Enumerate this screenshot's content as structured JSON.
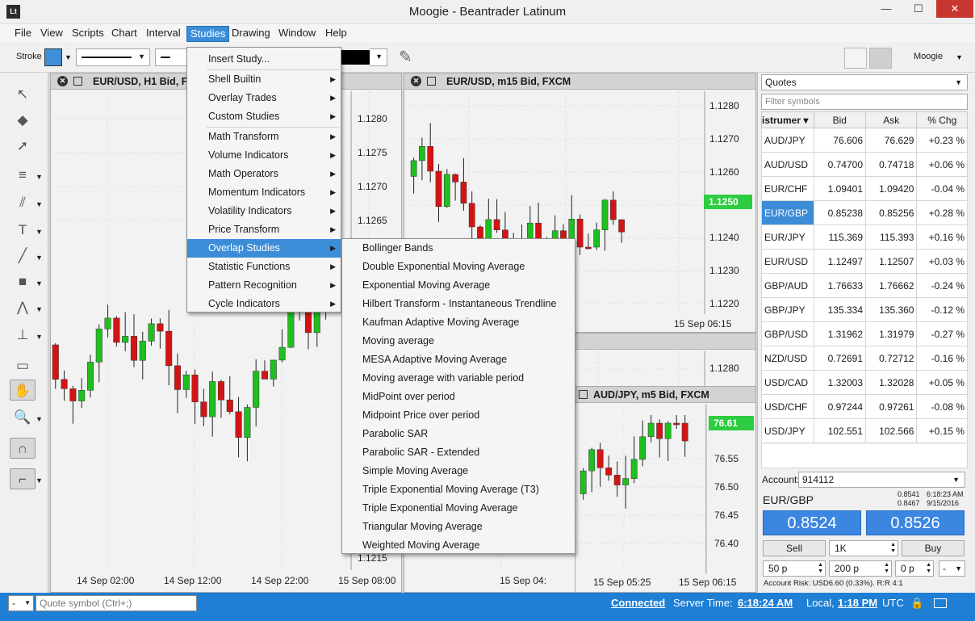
{
  "window": {
    "title": "Moogie - Beantrader Latinum",
    "app_icon": "Lt",
    "min": "—",
    "max": "☐",
    "close": "✕"
  },
  "menubar": [
    "File",
    "View",
    "Scripts",
    "Chart",
    "Interval",
    "Studies",
    "Drawing",
    "Window",
    "Help"
  ],
  "toolbar": {
    "stroke_label": "Stroke",
    "stroke_color": "#3d8fd8",
    "profile": "Moogie"
  },
  "charts": {
    "h1": {
      "title": "EUR/USD, H1 Bid, F",
      "prices": [
        "1.1280",
        "1.1275",
        "1.1270",
        "1.1265",
        "1.1215"
      ],
      "times": [
        "14 Sep 02:00",
        "14 Sep 12:00",
        "14 Sep 22:00",
        "15 Sep 08:00"
      ]
    },
    "m15": {
      "title": "EUR/USD, m15 Bid, FXCM",
      "prices": [
        "1.1280",
        "1.1270",
        "1.1260",
        "1.1240",
        "1.1230",
        "1.1220"
      ],
      "last_price": "1.1250",
      "time": "15 Sep 06:15"
    },
    "mid": {
      "price": "1.1280",
      "time": "15 Sep 04:"
    },
    "m5": {
      "title": "AUD/JPY, m5 Bid, FXCM",
      "prices": [
        "76.55",
        "76.50",
        "76.45",
        "76.40"
      ],
      "last_price": "76.61",
      "times": [
        "15 Sep 05:25",
        "15 Sep 06:15"
      ]
    }
  },
  "studies_menu": {
    "items": [
      {
        "label": "Insert Study...",
        "sub": false
      },
      {
        "label": "Shell Builtin",
        "sub": true
      },
      {
        "label": "Overlay Trades",
        "sub": true
      },
      {
        "label": "Custom Studies",
        "sub": true
      },
      {
        "label": "Math Transform",
        "sub": true
      },
      {
        "label": "Volume Indicators",
        "sub": true
      },
      {
        "label": "Math Operators",
        "sub": true
      },
      {
        "label": "Momentum Indicators",
        "sub": true
      },
      {
        "label": "Volatility Indicators",
        "sub": true
      },
      {
        "label": "Price Transform",
        "sub": true
      },
      {
        "label": "Overlap Studies",
        "sub": true
      },
      {
        "label": "Statistic Functions",
        "sub": true
      },
      {
        "label": "Pattern Recognition",
        "sub": true
      },
      {
        "label": "Cycle Indicators",
        "sub": true
      }
    ]
  },
  "overlap_menu": [
    "Bollinger Bands",
    "Double Exponential Moving Average",
    "Exponential Moving Average",
    "Hilbert Transform - Instantaneous Trendline",
    "Kaufman Adaptive Moving Average",
    "Moving average",
    "MESA Adaptive Moving Average",
    "Moving average with variable period",
    "MidPoint over period",
    "Midpoint Price over period",
    "Parabolic SAR",
    "Parabolic SAR - Extended",
    "Simple Moving Average",
    "Triple Exponential Moving Average (T3)",
    "Triple Exponential Moving Average",
    "Triangular Moving Average",
    "Weighted Moving Average"
  ],
  "quotes": {
    "selector": "Quotes",
    "filter_placeholder": "Filter symbols",
    "headers": [
      "istrumer",
      "Bid",
      "Ask",
      "% Chg"
    ],
    "rows": [
      {
        "sym": "AUD/JPY",
        "bid": "76.606",
        "ask": "76.629",
        "chg": "+0.23 %"
      },
      {
        "sym": "AUD/USD",
        "bid": "0.74700",
        "ask": "0.74718",
        "chg": "+0.06 %"
      },
      {
        "sym": "EUR/CHF",
        "bid": "1.09401",
        "ask": "1.09420",
        "chg": "-0.04 %"
      },
      {
        "sym": "EUR/GBP",
        "bid": "0.85238",
        "ask": "0.85256",
        "chg": "+0.28 %"
      },
      {
        "sym": "EUR/JPY",
        "bid": "115.369",
        "ask": "115.393",
        "chg": "+0.16 %"
      },
      {
        "sym": "EUR/USD",
        "bid": "1.12497",
        "ask": "1.12507",
        "chg": "+0.03 %"
      },
      {
        "sym": "GBP/AUD",
        "bid": "1.76633",
        "ask": "1.76662",
        "chg": "-0.24 %"
      },
      {
        "sym": "GBP/JPY",
        "bid": "135.334",
        "ask": "135.360",
        "chg": "-0.12 %"
      },
      {
        "sym": "GBP/USD",
        "bid": "1.31962",
        "ask": "1.31979",
        "chg": "-0.27 %"
      },
      {
        "sym": "NZD/USD",
        "bid": "0.72691",
        "ask": "0.72712",
        "chg": "-0.16 %"
      },
      {
        "sym": "USD/CAD",
        "bid": "1.32003",
        "ask": "1.32028",
        "chg": "+0.05 %"
      },
      {
        "sym": "USD/CHF",
        "bid": "0.97244",
        "ask": "0.97261",
        "chg": "-0.08 %"
      },
      {
        "sym": "USD/JPY",
        "bid": "102.551",
        "ask": "102.566",
        "chg": "+0.15 %"
      }
    ]
  },
  "trade": {
    "account_label": "Account:",
    "account": "914112",
    "pair": "EUR/GBP",
    "hi": "0.8541",
    "lo": "0.8467",
    "time": "6:18:23 AM",
    "date": "9/15/2016",
    "bid": "0.8524",
    "ask": "0.8526",
    "sell": "Sell",
    "qty": "1K",
    "buy": "Buy",
    "sl": "50 p",
    "tp": "200 p",
    "slip": "0 p",
    "dash": "-",
    "risk": "Account Risk: USD6.60 (0.33%). R:R 4:1"
  },
  "status": {
    "combo": "-",
    "symbol_placeholder": "Quote symbol (Ctrl+;)",
    "connected": "Connected",
    "server_label": "Server Time:",
    "server_time": "6:18:24 AM",
    "local_label": "Local,",
    "local_time": "1:18 PM",
    "tz": "UTC"
  }
}
